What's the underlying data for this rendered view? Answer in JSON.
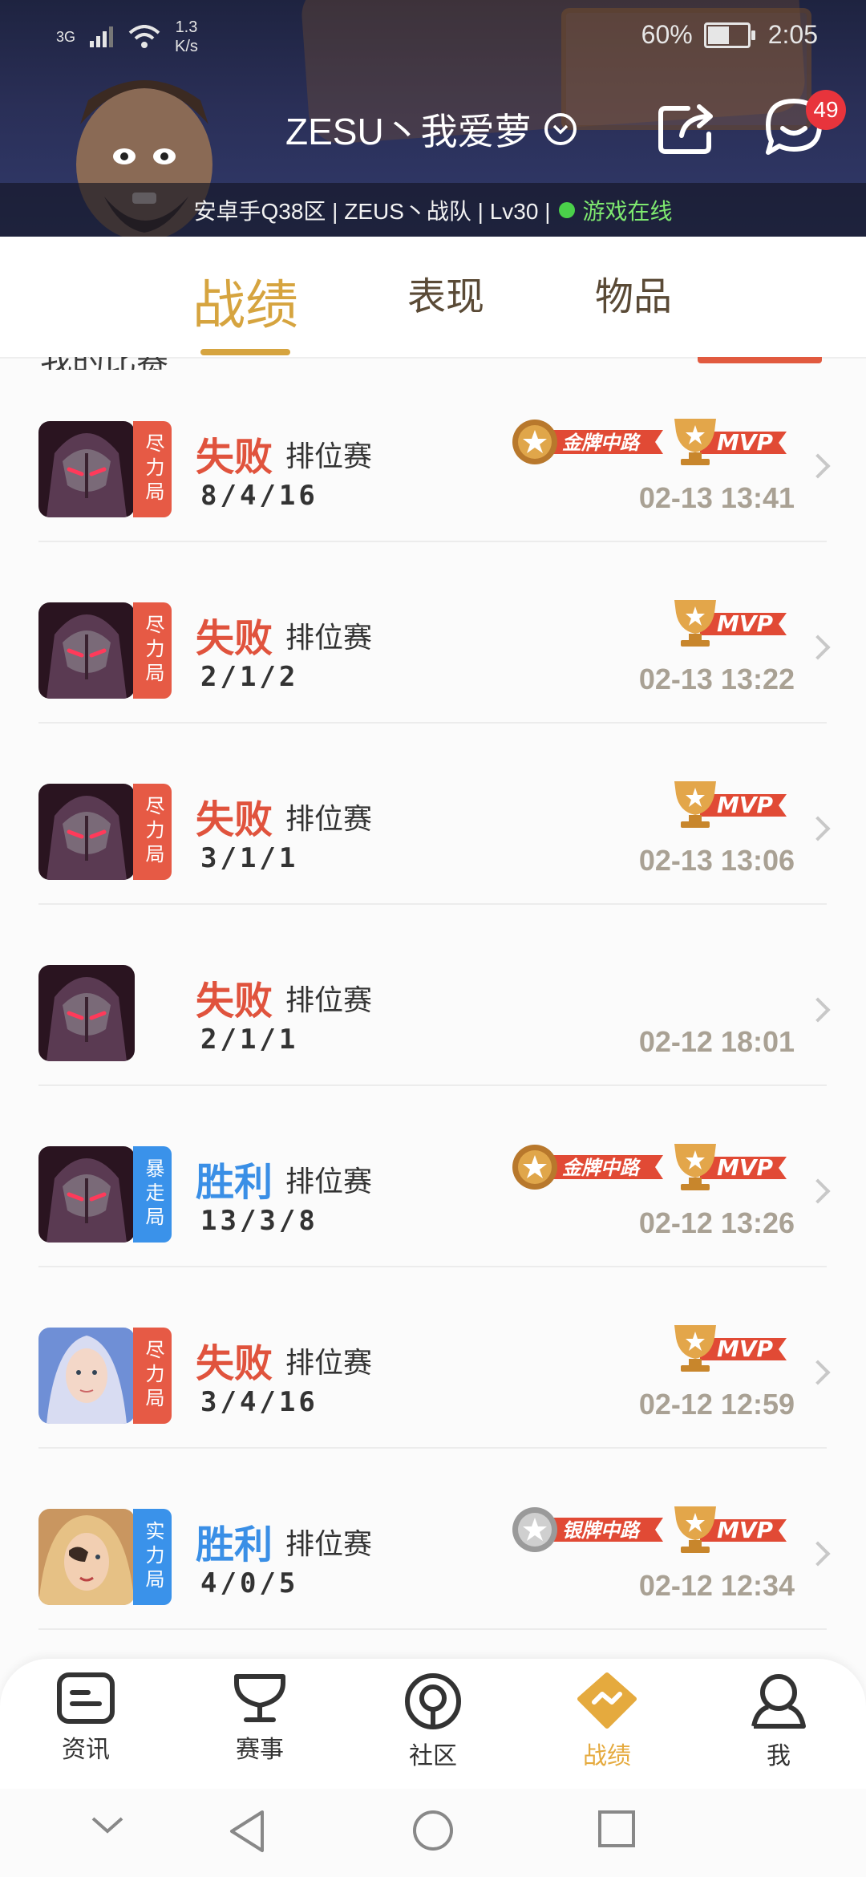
{
  "status_bar": {
    "network": "3G",
    "speed_value": "1.3",
    "speed_unit": "K/s",
    "battery": "60%",
    "battery_level": 0.6,
    "time": "2:05"
  },
  "header": {
    "title": "ZESU丶我爱萝",
    "unread_badge": "49",
    "info_text": "安卓手Q38区 | ZEUS丶战队 | Lv30 |",
    "online_text": "游戏在线"
  },
  "tabs": [
    {
      "label": "战绩",
      "active": true
    },
    {
      "label": "表现",
      "active": false
    },
    {
      "label": "物品",
      "active": false
    }
  ],
  "peek_text": "我的比赛",
  "colors": {
    "accent": "#d6a43f",
    "lose": "#e0533d",
    "win": "#3a8fe6",
    "online": "#4ad04a"
  },
  "matches": [
    {
      "tag": "尽力局",
      "tag_color": "red",
      "result": "失败",
      "outcome": "lose",
      "mode": "排位赛",
      "kda": "8/4/16",
      "time": "02-13 13:41",
      "medal": "金牌中路",
      "mvp": true,
      "hero": "dark"
    },
    {
      "tag": "尽力局",
      "tag_color": "red",
      "result": "失败",
      "outcome": "lose",
      "mode": "排位赛",
      "kda": "2/1/2",
      "time": "02-13 13:22",
      "medal": "",
      "mvp": true,
      "hero": "dark"
    },
    {
      "tag": "尽力局",
      "tag_color": "red",
      "result": "失败",
      "outcome": "lose",
      "mode": "排位赛",
      "kda": "3/1/1",
      "time": "02-13 13:06",
      "medal": "",
      "mvp": true,
      "hero": "dark"
    },
    {
      "tag": "",
      "tag_color": "",
      "result": "失败",
      "outcome": "lose",
      "mode": "排位赛",
      "kda": "2/1/1",
      "time": "02-12 18:01",
      "medal": "",
      "mvp": false,
      "hero": "dark"
    },
    {
      "tag": "暴走局",
      "tag_color": "blue",
      "result": "胜利",
      "outcome": "win",
      "mode": "排位赛",
      "kda": "13/3/8",
      "time": "02-12 13:26",
      "medal": "金牌中路",
      "mvp": true,
      "hero": "dark"
    },
    {
      "tag": "尽力局",
      "tag_color": "red",
      "result": "失败",
      "outcome": "lose",
      "mode": "排位赛",
      "kda": "3/4/16",
      "time": "02-12 12:59",
      "medal": "",
      "mvp": true,
      "hero": "light"
    },
    {
      "tag": "实力局",
      "tag_color": "blue",
      "result": "胜利",
      "outcome": "win",
      "mode": "排位赛",
      "kda": "4/0/5",
      "time": "02-12 12:34",
      "medal": "银牌中路",
      "mvp": true,
      "hero": "gold"
    }
  ],
  "mvp_label": "MVP",
  "bottom_nav": [
    {
      "label": "资讯",
      "icon": "news-icon",
      "active": false
    },
    {
      "label": "赛事",
      "icon": "trophy-icon",
      "active": false
    },
    {
      "label": "社区",
      "icon": "community-icon",
      "active": false
    },
    {
      "label": "战绩",
      "icon": "record-icon",
      "active": true
    },
    {
      "label": "我",
      "icon": "profile-icon",
      "active": false
    }
  ]
}
